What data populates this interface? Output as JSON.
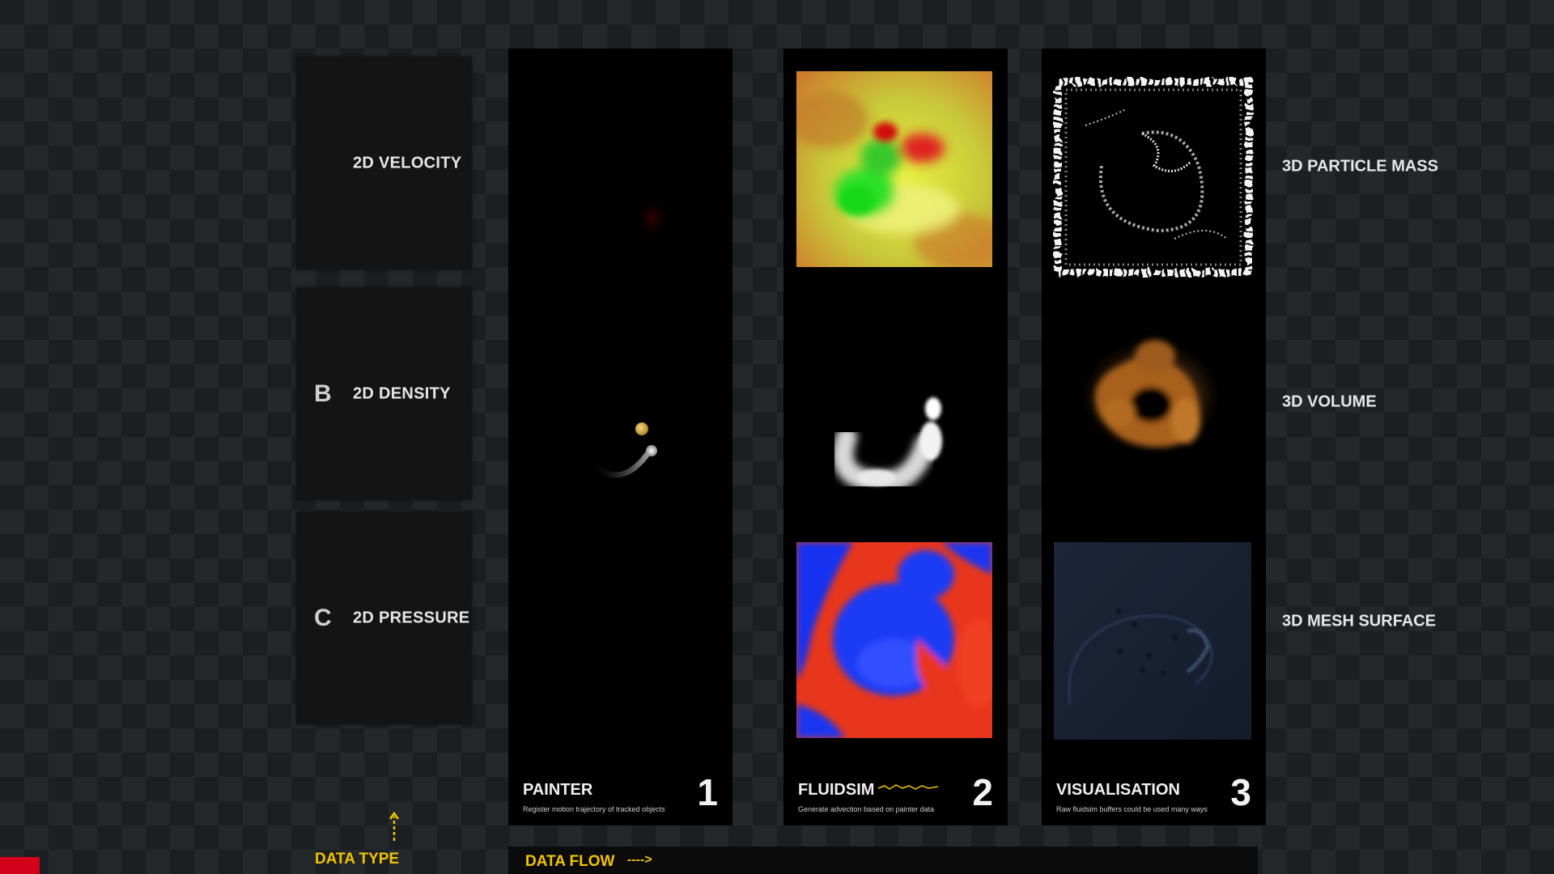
{
  "data_types": [
    {
      "letter": "",
      "label": "2D VELOCITY"
    },
    {
      "letter": "B",
      "label": "2D DENSITY"
    },
    {
      "letter": "C",
      "label": "2D PRESSURE"
    }
  ],
  "columns": [
    {
      "title": "PAINTER",
      "subtitle": "Register motion trajectory of tracked objects",
      "number": "1"
    },
    {
      "title": "FLUIDSIM",
      "subtitle": "Generate advection based on painter data",
      "number": "2"
    },
    {
      "title": "VISUALISATION",
      "subtitle": "Raw fluidsim buffers could be used many ways",
      "number": "3"
    }
  ],
  "outputs": [
    "3D PARTICLE MASS",
    "3D VOLUME",
    "3D MESH SURFACE"
  ],
  "bottom": {
    "data_type_label": "DATA TYPE",
    "data_flow_label": "DATA FLOW",
    "data_flow_arrow": "---->"
  },
  "colors": {
    "accent": "#f0c400",
    "panel": "#000000",
    "tile": "#141414",
    "marker": "#d4001a"
  }
}
